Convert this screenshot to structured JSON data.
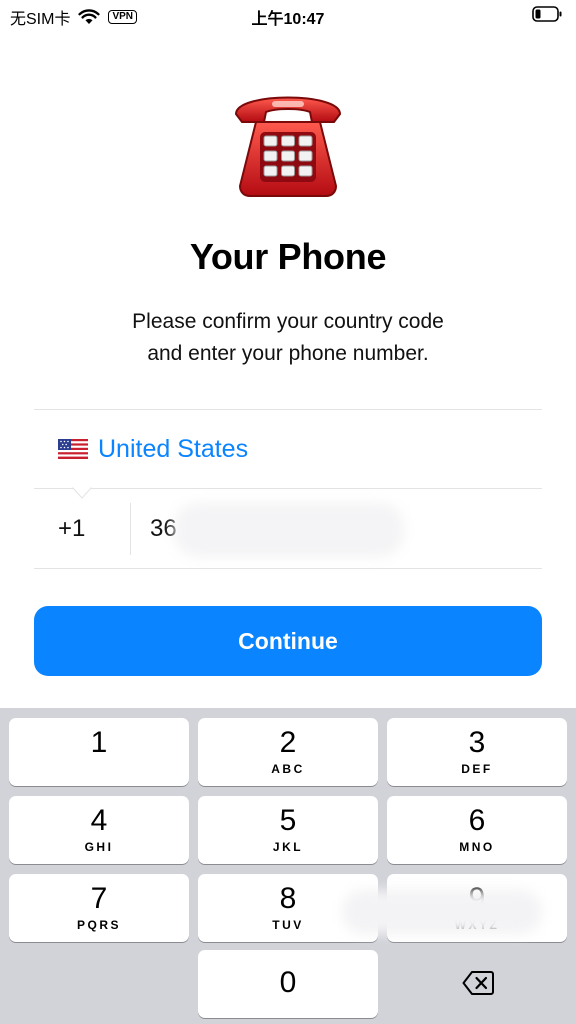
{
  "status_bar": {
    "carrier": "无SIM卡",
    "vpn": "VPN",
    "time": "上午10:47"
  },
  "hero": {
    "icon": "telephone-emoji",
    "title": "Your Phone",
    "subtitle_line1": "Please confirm your country code",
    "subtitle_line2": "and enter your phone number."
  },
  "country": {
    "flag": "us-flag-icon",
    "name": "United States"
  },
  "phone": {
    "code": "+1",
    "number": "36"
  },
  "continue_label": "Continue",
  "keypad": {
    "keys": [
      {
        "digit": "1",
        "letters": ""
      },
      {
        "digit": "2",
        "letters": "ABC"
      },
      {
        "digit": "3",
        "letters": "DEF"
      },
      {
        "digit": "4",
        "letters": "GHI"
      },
      {
        "digit": "5",
        "letters": "JKL"
      },
      {
        "digit": "6",
        "letters": "MNO"
      },
      {
        "digit": "7",
        "letters": "PQRS"
      },
      {
        "digit": "8",
        "letters": "TUV"
      },
      {
        "digit": "9",
        "letters": "WXYZ"
      },
      {
        "digit": "0",
        "letters": ""
      }
    ],
    "backspace_icon": "delete-backward-icon"
  },
  "colors": {
    "accent": "#0a84ff",
    "keypad_bg": "#d1d3d9",
    "phone_red": "#d8141c"
  }
}
